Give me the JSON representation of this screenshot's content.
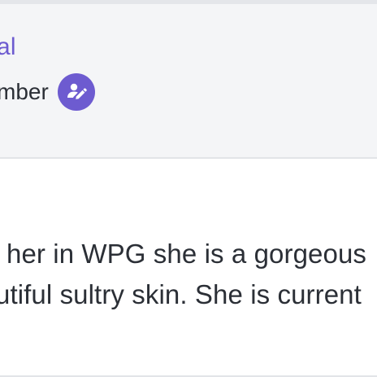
{
  "author": {
    "name_fragment": "al",
    "role_fragment": "mber"
  },
  "badge": {
    "icon": "edit-user-icon",
    "color": "#6d5bd0"
  },
  "post": {
    "lines": [
      "her in WPG she is a gorgeous",
      "utiful sultry skin. She is current"
    ]
  },
  "colors": {
    "accent": "#6d5bd0",
    "text": "#2b2f36",
    "header_bg": "#f4f5f7",
    "content_bg": "#ffffff"
  }
}
